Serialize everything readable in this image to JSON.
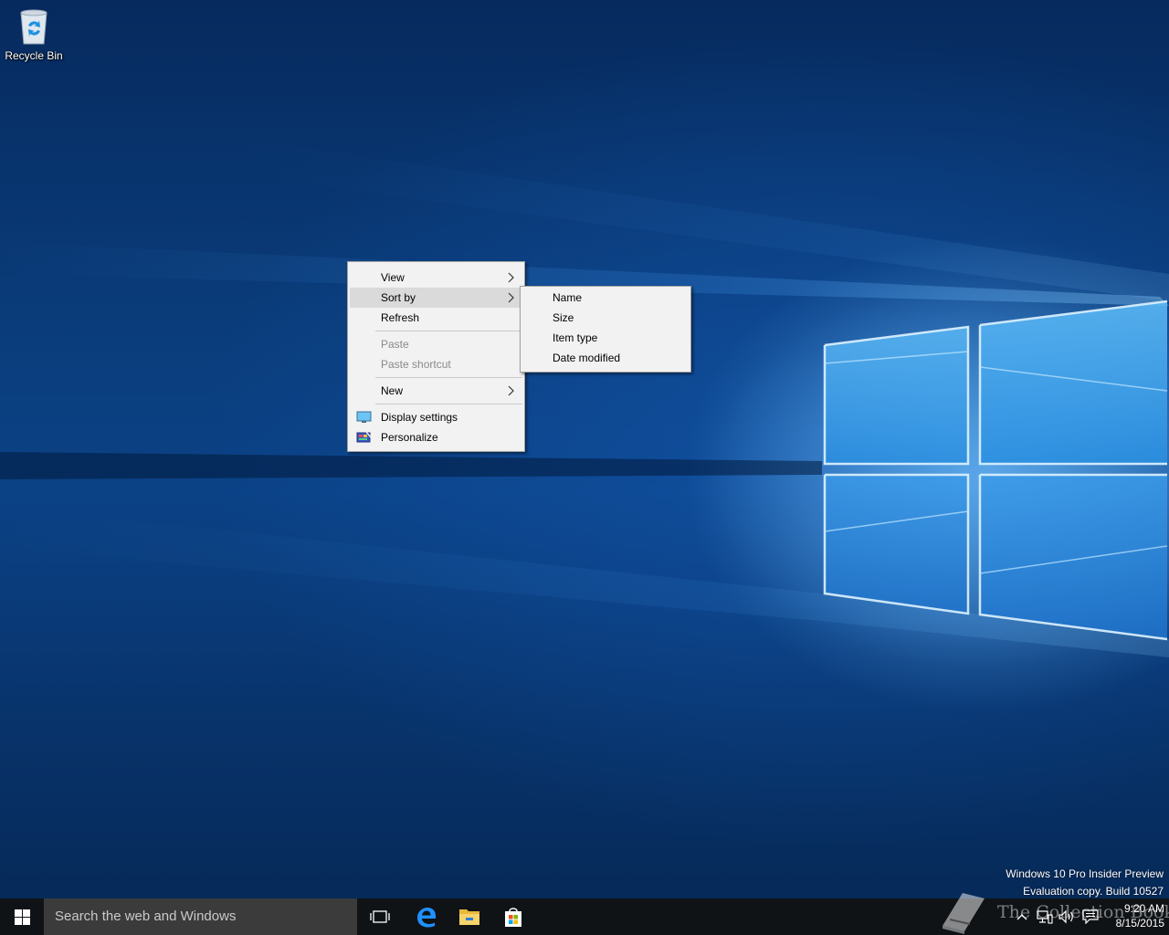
{
  "desktop": {
    "icons": [
      {
        "label": "Recycle Bin",
        "icon": "recycle-bin-icon"
      }
    ]
  },
  "context_menu": {
    "items": {
      "view": {
        "label": "View",
        "has_submenu": true
      },
      "sort_by": {
        "label": "Sort by",
        "has_submenu": true,
        "highlighted": true
      },
      "refresh": {
        "label": "Refresh"
      },
      "paste": {
        "label": "Paste",
        "disabled": true
      },
      "paste_shortcut": {
        "label": "Paste shortcut",
        "disabled": true
      },
      "new": {
        "label": "New",
        "has_submenu": true
      },
      "display_settings": {
        "label": "Display settings",
        "icon": "display-settings-icon"
      },
      "personalize": {
        "label": "Personalize",
        "icon": "personalize-icon"
      }
    }
  },
  "sort_submenu": {
    "items": [
      "Name",
      "Size",
      "Item type",
      "Date modified"
    ]
  },
  "watermark": {
    "line1": "Windows 10 Pro Insider Preview",
    "line2": "Evaluation copy. Build 10527"
  },
  "taskbar": {
    "search_placeholder": "Search the web and Windows",
    "pinned": [
      "task-view-icon",
      "edge-icon",
      "file-explorer-icon",
      "store-icon"
    ],
    "clock_time": "9:20 AM",
    "clock_date": "8/15/2015"
  },
  "overlay": {
    "logo_text": "The Collection Book"
  },
  "colors": {
    "taskbar": "#101316",
    "search_box": "#3b3b3b",
    "menu_bg": "#f2f2f2",
    "menu_highlight": "#dadada",
    "accent": "#1e90ff"
  }
}
